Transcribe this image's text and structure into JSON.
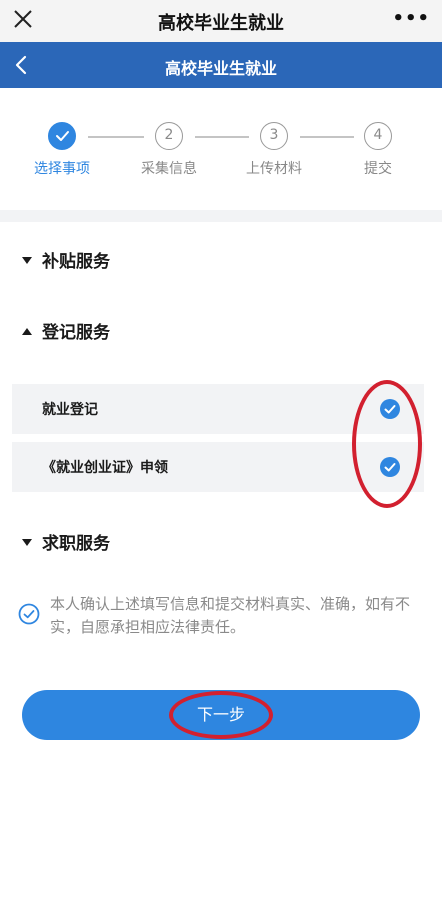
{
  "topbar": {
    "title": "高校毕业生就业",
    "close_icon": "close-icon",
    "more_label": "•••"
  },
  "navbar": {
    "title": "高校毕业生就业",
    "back_icon": "chevron-left-icon"
  },
  "stepper": {
    "steps": [
      {
        "number": "",
        "label": "选择事项",
        "state": "done"
      },
      {
        "number": "2",
        "label": "采集信息",
        "state": "pending"
      },
      {
        "number": "3",
        "label": "上传材料",
        "state": "pending"
      },
      {
        "number": "4",
        "label": "提交",
        "state": "pending"
      }
    ]
  },
  "sections": {
    "subsidy": {
      "title": "补贴服务",
      "expanded": false
    },
    "registration": {
      "title": "登记服务",
      "expanded": true,
      "items": [
        {
          "label": "就业登记",
          "checked": true
        },
        {
          "label": "《就业创业证》申领",
          "checked": true
        }
      ]
    },
    "job": {
      "title": "求职服务",
      "expanded": false
    }
  },
  "confirm": {
    "text": "本人确认上述填写信息和提交材料真实、准确，如有不实，自愿承担相应法律责任。",
    "checked": true
  },
  "next_button": {
    "label": "下一步"
  },
  "colors": {
    "primary": "#2f86e0",
    "header": "#2b67b8",
    "annotation": "#d2202f"
  }
}
